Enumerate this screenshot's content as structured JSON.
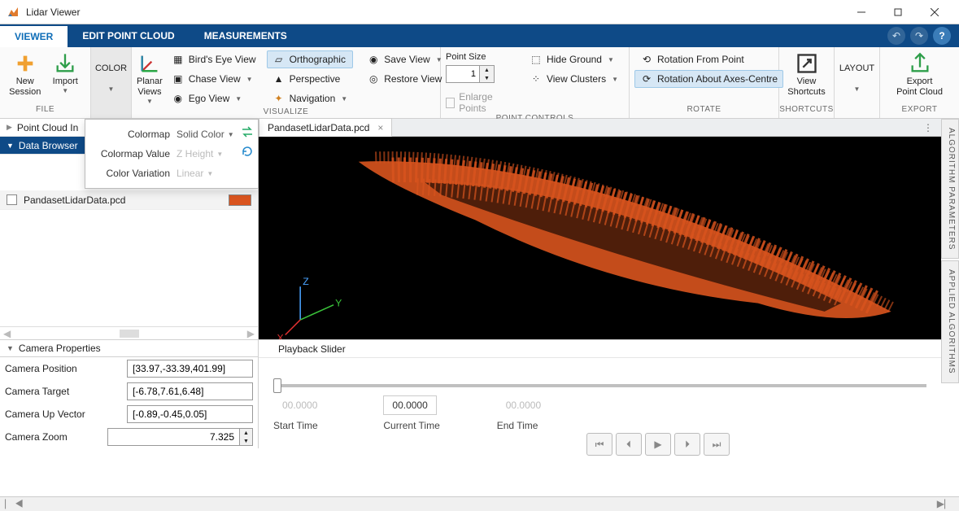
{
  "title": "Lidar Viewer",
  "tabs": {
    "viewer": "VIEWER",
    "edit": "EDIT POINT CLOUD",
    "meas": "MEASUREMENTS"
  },
  "ribbon": {
    "file": {
      "new_session": "New\nSession",
      "import": "Import",
      "label": "FILE"
    },
    "color": {
      "btn": "COLOR"
    },
    "visualize": {
      "planar": "Planar\nViews",
      "birds": "Bird's Eye View",
      "chase": "Chase View",
      "ego": "Ego View",
      "ortho": "Orthographic",
      "persp": "Perspective",
      "nav": "Navigation",
      "save": "Save View",
      "restore": "Restore View",
      "label": "VISUALIZE"
    },
    "point": {
      "size": "Point Size",
      "size_val": "1",
      "enlarge": "Enlarge Points",
      "hide": "Hide Ground",
      "clusters": "View Clusters",
      "label": "POINT CONTROLS"
    },
    "rotate": {
      "from_point": "Rotation From Point",
      "axes_centre": "Rotation About Axes-Centre",
      "label": "ROTATE"
    },
    "shortcuts": {
      "btn": "View\nShortcuts",
      "label": "SHORTCUTS"
    },
    "layout": {
      "btn": "LAYOUT"
    },
    "export": {
      "btn": "Export\nPoint Cloud",
      "label": "EXPORT"
    }
  },
  "accordion": {
    "pci": "Point Cloud In",
    "db": "Data Browser"
  },
  "colorpop": {
    "colormap": "Colormap",
    "colormap_val": "Solid Color",
    "cmv": "Colormap Value",
    "cmv_val": "Z Height",
    "cv": "Color Variation",
    "cv_val": "Linear"
  },
  "file": {
    "name": "PandasetLidarData.pcd"
  },
  "camprops": {
    "title": "Camera Properties",
    "pos_l": "Camera Position",
    "pos_v": "[33.97,-33.39,401.99]",
    "tgt_l": "Camera Target",
    "tgt_v": "[-6.78,7.61,6.48]",
    "up_l": "Camera Up Vector",
    "up_v": "[-0.89,-0.45,0.05]",
    "zoom_l": "Camera Zoom",
    "zoom_v": "7.325"
  },
  "playback": {
    "title": "Playback Slider",
    "start_t": "00.0000",
    "cur_t": "00.0000",
    "end_t": "00.0000",
    "start_l": "Start Time",
    "cur_l": "Current Time",
    "end_l": "End Time"
  },
  "sidetabs": {
    "alg_params": "ALGORITHM PARAMETERS",
    "app_alg": "APPLIED ALGORITHMS"
  },
  "colors": {
    "accent": "#0e4a87",
    "point": "#d9541e"
  }
}
